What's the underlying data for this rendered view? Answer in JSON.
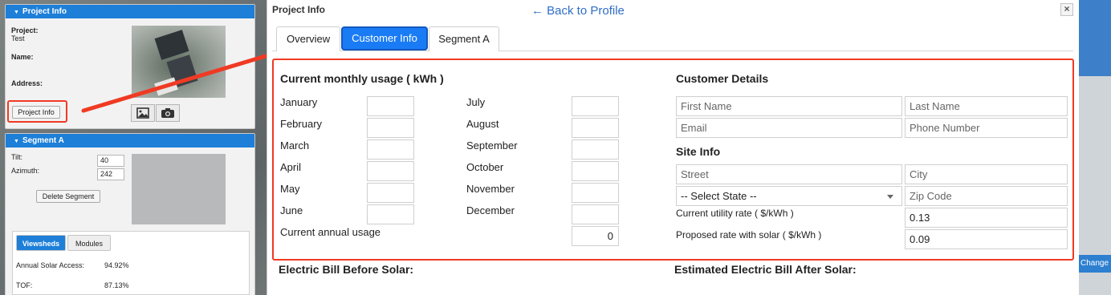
{
  "sidebar": {
    "project_panel": {
      "title": "Project Info",
      "project_label": "Project:",
      "project_value": "Test",
      "name_label": "Name:",
      "address_label": "Address:",
      "project_info_button": "Project Info"
    },
    "segment_panel": {
      "title": "Segment A",
      "tilt_label": "Tilt:",
      "tilt_value": "40",
      "azimuth_label": "Azimuth:",
      "azimuth_value": "242",
      "delete_button": "Delete Segment",
      "tabs": [
        {
          "label": "Viewsheds",
          "active": true
        },
        {
          "label": "Modules",
          "active": false
        }
      ],
      "stats": [
        {
          "label": "Annual Solar Access:",
          "value": "94.92%"
        },
        {
          "label": "TOF:",
          "value": "87.13%"
        }
      ]
    }
  },
  "background": {
    "change_label": "Change"
  },
  "modal": {
    "title": "Project Info",
    "back_link": "← Back to Profile",
    "close": "×",
    "tabs": [
      {
        "label": "Overview",
        "active": false
      },
      {
        "label": "Customer Info",
        "active": true
      },
      {
        "label": "Segment A",
        "active": false
      }
    ],
    "usage": {
      "heading": "Current monthly usage ( kWh )",
      "months_left": [
        "January",
        "February",
        "March",
        "April",
        "May",
        "June"
      ],
      "months_right": [
        "July",
        "August",
        "September",
        "October",
        "November",
        "December"
      ],
      "annual_label": "Current annual usage",
      "annual_value": "0"
    },
    "customer": {
      "heading": "Customer Details",
      "first_name_placeholder": "First Name",
      "last_name_placeholder": "Last Name",
      "email_placeholder": "Email",
      "phone_placeholder": "Phone Number"
    },
    "site": {
      "heading": "Site Info",
      "street_placeholder": "Street",
      "city_placeholder": "City",
      "state_select": "-- Select State --",
      "zip_placeholder": "Zip Code",
      "utility_rate_label": "Current utility rate ( $/kWh )",
      "utility_rate_value": "0.13",
      "solar_rate_label": "Proposed rate with solar ( $/kWh )",
      "solar_rate_value": "0.09"
    },
    "bill_before_heading": "Electric Bill Before Solar:",
    "bill_after_heading": "Estimated Electric Bill After Solar:"
  },
  "colors": {
    "accent": "#1a7cf5",
    "panel_header": "#1d7fd8",
    "annotation_red": "#f03a23",
    "link": "#2f6ec6"
  }
}
